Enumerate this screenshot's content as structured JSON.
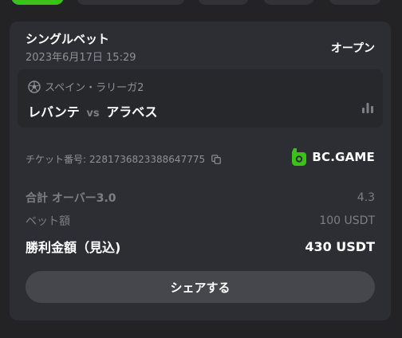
{
  "bet": {
    "title": "シングルベット",
    "datetime": "2023年6月17日 15:29",
    "status": "オープン",
    "league": "スペイン・ラリーガ2",
    "home_team": "レバンテ",
    "vs": "vs",
    "away_team": "アラベス",
    "ticket_label": "チケット番号:",
    "ticket_number": "2281736823388647775",
    "brand": "BC.GAME",
    "rows": [
      {
        "label": "合計 オーバー3.0",
        "value": "4.3"
      },
      {
        "label": "ベット額",
        "value": "100 USDT"
      },
      {
        "label": "勝利金額（見込)",
        "value": "430 USDT"
      }
    ],
    "share_label": "シェアする"
  },
  "icons": {
    "league": "soccer-ball-icon",
    "stats": "bar-chart-icon",
    "copy": "copy-icon",
    "brand": "bc-game-logo"
  },
  "colors": {
    "accent": "#3bc117",
    "card": "#2d2e33",
    "muted": "#8f9098"
  }
}
